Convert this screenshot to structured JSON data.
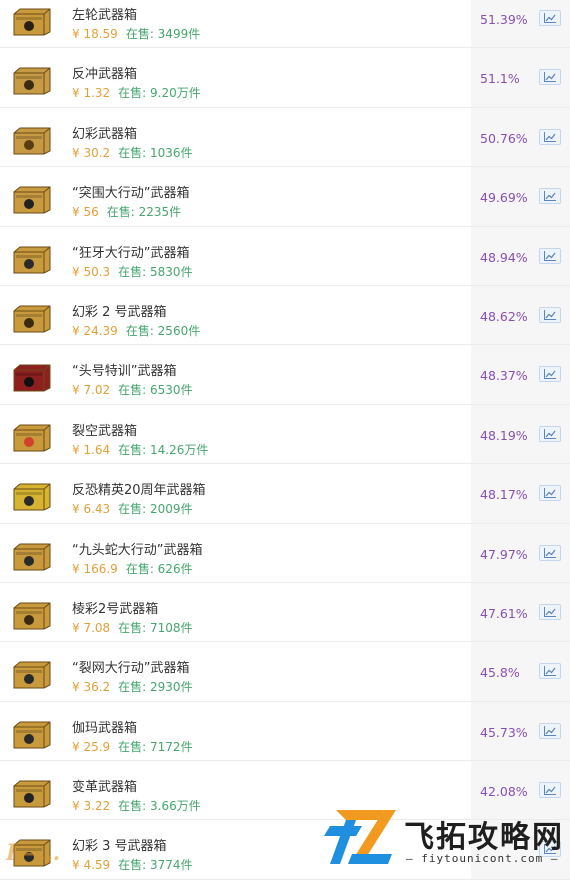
{
  "items": [
    {
      "name": "左轮武器箱",
      "price": "¥ 18.59",
      "on_sale": "在售: 3499件",
      "percent": "51.39%",
      "case_color": "#c89a3c",
      "case_emblem": "#2a1f10"
    },
    {
      "name": "反冲武器箱",
      "price": "¥ 1.32",
      "on_sale": "在售: 9.20万件",
      "percent": "51.1%",
      "case_color": "#c79a45",
      "case_emblem": "#3a2b12"
    },
    {
      "name": "幻彩武器箱",
      "price": "¥ 30.2",
      "on_sale": "在售: 1036件",
      "percent": "50.76%",
      "case_color": "#c69a45",
      "case_emblem": "#5b3d12"
    },
    {
      "name": "“突围大行动”武器箱",
      "price": "¥ 56",
      "on_sale": "在售: 2235件",
      "percent": "49.69%",
      "case_color": "#c99b40",
      "case_emblem": "#222222"
    },
    {
      "name": "“狂牙大行动”武器箱",
      "price": "¥ 50.3",
      "on_sale": "在售: 5830件",
      "percent": "48.94%",
      "case_color": "#c89b3e",
      "case_emblem": "#2b2b2b"
    },
    {
      "name": "幻彩 2 号武器箱",
      "price": "¥ 24.39",
      "on_sale": "在售: 2560件",
      "percent": "48.62%",
      "case_color": "#c99a3d",
      "case_emblem": "#3b2a10"
    },
    {
      "name": "“头号特训”武器箱",
      "price": "¥ 7.02",
      "on_sale": "在售: 6530件",
      "percent": "48.37%",
      "case_color": "#8e1f1f",
      "case_emblem": "#111111"
    },
    {
      "name": "裂空武器箱",
      "price": "¥ 1.64",
      "on_sale": "在售: 14.26万件",
      "percent": "48.19%",
      "case_color": "#c89a3c",
      "case_emblem": "#d0432a"
    },
    {
      "name": "反恐精英20周年武器箱",
      "price": "¥ 6.43",
      "on_sale": "在售: 2009件",
      "percent": "48.17%",
      "case_color": "#d6b431",
      "case_emblem": "#2a2a2a"
    },
    {
      "name": "“九头蛇大行动”武器箱",
      "price": "¥ 166.9",
      "on_sale": "在售: 626件",
      "percent": "47.97%",
      "case_color": "#c99a3d",
      "case_emblem": "#2a2a2a"
    },
    {
      "name": "棱彩2号武器箱",
      "price": "¥ 7.08",
      "on_sale": "在售: 7108件",
      "percent": "47.61%",
      "case_color": "#c89a3c",
      "case_emblem": "#3a2a14"
    },
    {
      "name": "“裂网大行动”武器箱",
      "price": "¥ 36.2",
      "on_sale": "在售: 2930件",
      "percent": "45.8%",
      "case_color": "#c89a3c",
      "case_emblem": "#2a2a2a"
    },
    {
      "name": "伽玛武器箱",
      "price": "¥ 25.9",
      "on_sale": "在售: 7172件",
      "percent": "45.73%",
      "case_color": "#c89a3c",
      "case_emblem": "#2a2a2a"
    },
    {
      "name": "变革武器箱",
      "price": "¥ 3.22",
      "on_sale": "在售: 3.66万件",
      "percent": "42.08%",
      "case_color": "#c89a3c",
      "case_emblem": "#222222"
    },
    {
      "name": "幻彩 3 号武器箱",
      "price": "¥ 4.59",
      "on_sale": "在售: 3774件",
      "percent": "",
      "case_color": "#c89a3c",
      "case_emblem": "#2a2a2a"
    }
  ],
  "icons": {
    "case": "weapon-case-icon",
    "chart": "trend-chart-icon"
  },
  "watermark": {
    "title": "飞拓攻略网",
    "domain": "— fiytounicont.com —",
    "left_text": "I—…"
  },
  "colors": {
    "price": "#e3a03a",
    "on_sale": "#46a66e",
    "percent": "#8a4fb5",
    "logo_orange": "#f29a1f",
    "logo_blue": "#1f8fe0"
  }
}
